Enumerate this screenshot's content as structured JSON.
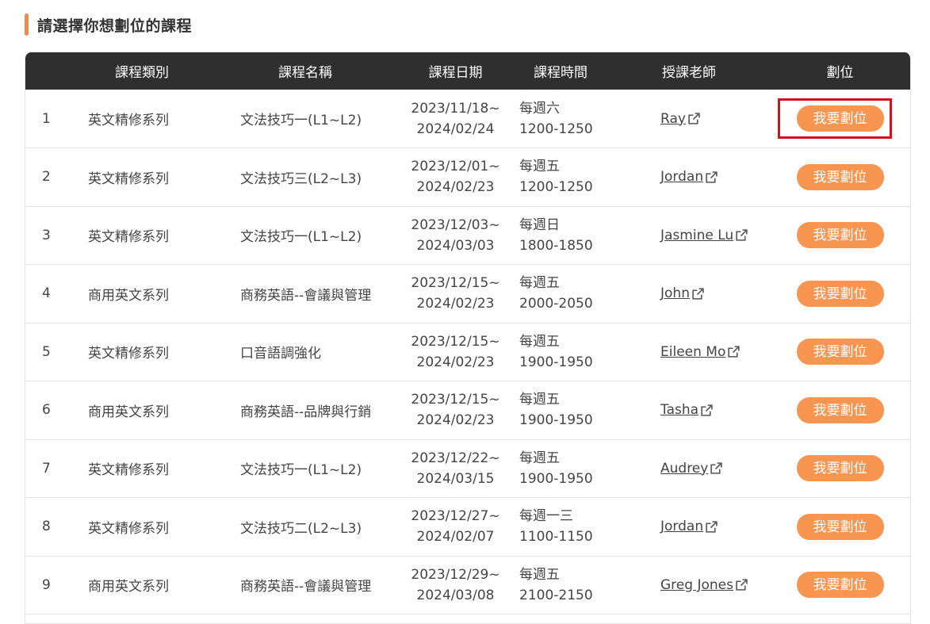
{
  "section": {
    "title": "請選擇你想劃位的課程"
  },
  "table": {
    "headers": [
      "課程類別",
      "課程名稱",
      "課程日期",
      "課程時間",
      "授課老師",
      "劃位"
    ],
    "rows": [
      {
        "idx": "1",
        "category": "英文精修系列",
        "name": "文法技巧一(L1~L2)",
        "date_start": "2023/11/18~",
        "date_end": "2024/02/24",
        "day": "每週六",
        "time": "1200-1250",
        "teacher": "Ray",
        "action": "我要劃位"
      },
      {
        "idx": "2",
        "category": "英文精修系列",
        "name": "文法技巧三(L2~L3)",
        "date_start": "2023/12/01~",
        "date_end": "2024/02/23",
        "day": "每週五",
        "time": "1200-1250",
        "teacher": "Jordan",
        "action": "我要劃位"
      },
      {
        "idx": "3",
        "category": "英文精修系列",
        "name": "文法技巧一(L1~L2)",
        "date_start": "2023/12/03~",
        "date_end": "2024/03/03",
        "day": "每週日",
        "time": "1800-1850",
        "teacher": "Jasmine Lu",
        "action": "我要劃位"
      },
      {
        "idx": "4",
        "category": "商用英文系列",
        "name": "商務英語--會議與管理",
        "date_start": "2023/12/15~",
        "date_end": "2024/02/23",
        "day": "每週五",
        "time": "2000-2050",
        "teacher": "John",
        "action": "我要劃位"
      },
      {
        "idx": "5",
        "category": "英文精修系列",
        "name": "口音語調強化",
        "date_start": "2023/12/15~",
        "date_end": "2024/02/23",
        "day": "每週五",
        "time": "1900-1950",
        "teacher": "Eileen Mo",
        "action": "我要劃位"
      },
      {
        "idx": "6",
        "category": "商用英文系列",
        "name": "商務英語--品牌與行銷",
        "date_start": "2023/12/15~",
        "date_end": "2024/02/23",
        "day": "每週五",
        "time": "1900-1950",
        "teacher": "Tasha",
        "action": "我要劃位"
      },
      {
        "idx": "7",
        "category": "英文精修系列",
        "name": "文法技巧一(L1~L2)",
        "date_start": "2023/12/22~",
        "date_end": "2024/03/15",
        "day": "每週五",
        "time": "1900-1950",
        "teacher": "Audrey",
        "action": "我要劃位"
      },
      {
        "idx": "8",
        "category": "英文精修系列",
        "name": "文法技巧二(L2~L3)",
        "date_start": "2023/12/27~",
        "date_end": "2024/02/07",
        "day": "每週一三",
        "time": "1100-1150",
        "teacher": "Jordan",
        "action": "我要劃位"
      },
      {
        "idx": "9",
        "category": "商用英文系列",
        "name": "商務英語--會議與管理",
        "date_start": "2023/12/29~",
        "date_end": "2024/03/08",
        "day": "每週五",
        "time": "2100-2150",
        "teacher": "Greg Jones",
        "action": "我要劃位"
      }
    ]
  },
  "colors": {
    "accent": "#f89551",
    "header_bg": "#2f2f2f",
    "highlight": "#d4121a"
  },
  "icons": {
    "teacher_link": "external-link-icon"
  }
}
